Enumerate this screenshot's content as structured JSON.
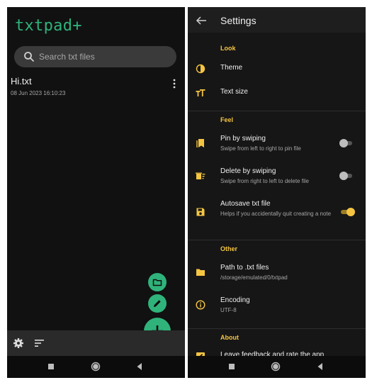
{
  "left": {
    "app_title": "txtpad+",
    "search": {
      "placeholder": "Search txt files"
    },
    "files": [
      {
        "name": "Hi.txt",
        "modified": "08 Jun 2023 16:10:23"
      }
    ],
    "fabs": {
      "folder_icon": "folder-icon",
      "edit_icon": "pencil-icon",
      "add_icon": "plus-icon"
    },
    "bottom_bar": {
      "settings_icon": "gear-icon",
      "sort_icon": "sort-icon"
    },
    "navbar": [
      "recents",
      "home",
      "back"
    ]
  },
  "right": {
    "topbar": {
      "title": "Settings",
      "back_icon": "arrow-left-icon"
    },
    "sections": {
      "look": "Look",
      "feel": "Feel",
      "other": "Other",
      "about": "About"
    },
    "items": {
      "theme": {
        "title": "Theme"
      },
      "text_size": {
        "title": "Text size"
      },
      "pin": {
        "title": "Pin by swiping",
        "subtitle": "Swipe from left to right to pin file",
        "enabled": false
      },
      "delete": {
        "title": "Delete by swiping",
        "subtitle": "Swipe from right to left to delete file",
        "enabled": false
      },
      "autosave": {
        "title": "Autosave txt file",
        "subtitle": "Helps if you accidentally quit creating a note",
        "enabled": true
      },
      "path": {
        "title": "Path to .txt files",
        "subtitle": "/storage/emulated/0/txtpad"
      },
      "encoding": {
        "title": "Encoding",
        "subtitle": "UTF-8"
      },
      "feedback": {
        "title": "Leave feedback and rate the app"
      }
    }
  },
  "colors": {
    "accent_green": "#2fb37b",
    "accent_yellow": "#f5c542",
    "background": "#161616"
  }
}
